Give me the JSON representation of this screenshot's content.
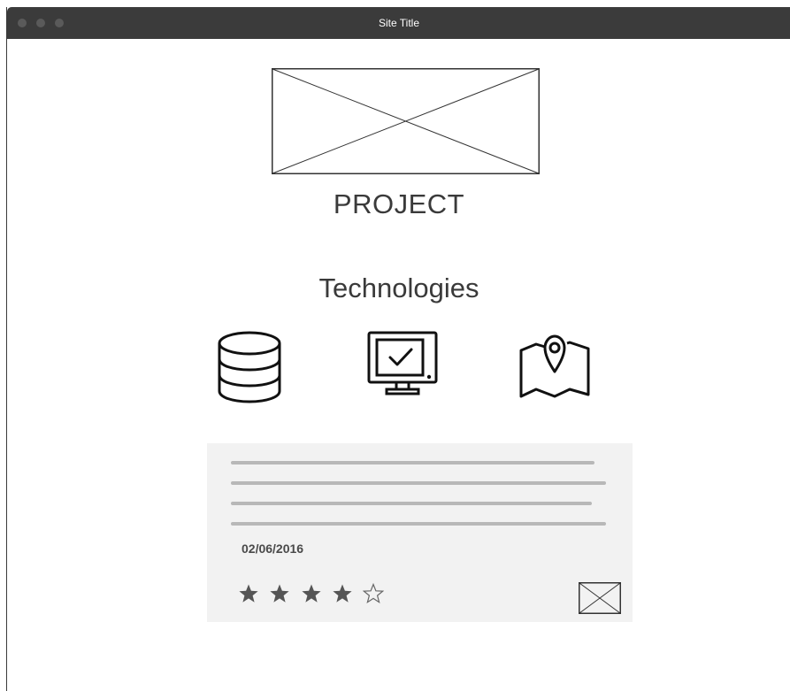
{
  "window": {
    "title": "Site Title"
  },
  "hero": {
    "image_icon": "image-placeholder-icon"
  },
  "project": {
    "title": "PROJECT"
  },
  "technologies": {
    "heading": "Technologies",
    "icons": [
      "database-icon",
      "monitor-check-icon",
      "map-pin-icon"
    ]
  },
  "card": {
    "date": "02/06/2016",
    "rating": {
      "value": 4,
      "max": 5
    },
    "thumbnail_icon": "image-placeholder-icon"
  },
  "colors": {
    "titlebar": "#3b3b3b",
    "card_bg": "#f2f2f2",
    "text_line": "#b8b8b8",
    "star": "#555555"
  }
}
